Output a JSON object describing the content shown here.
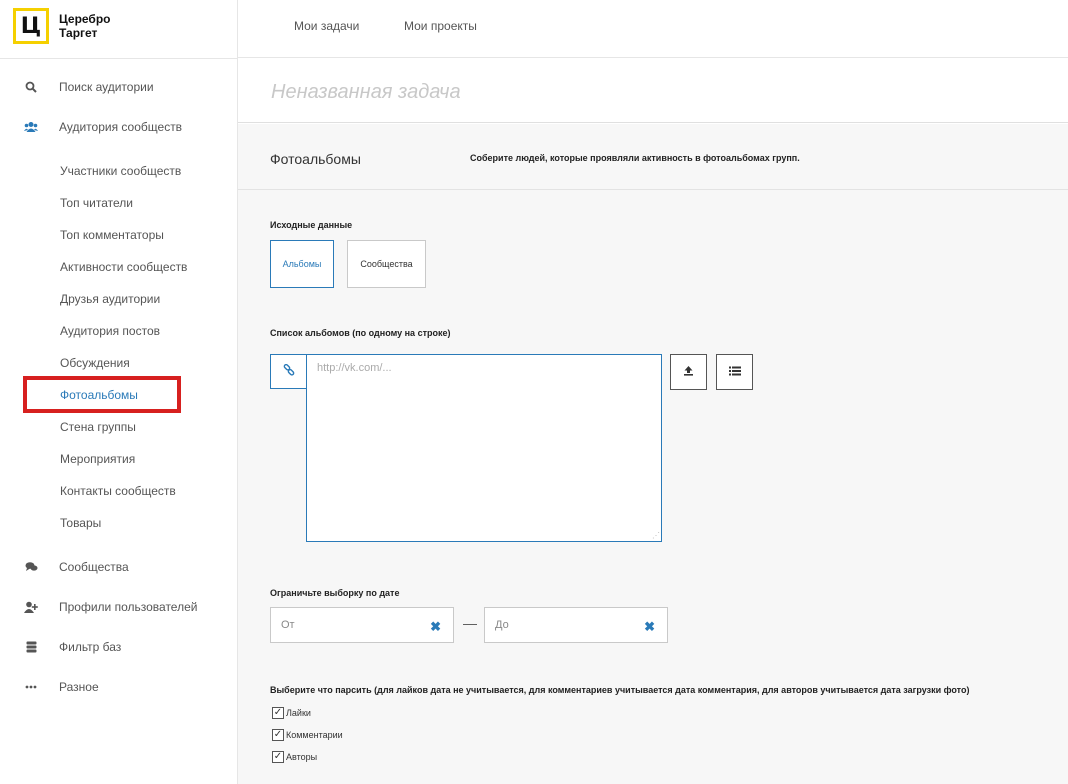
{
  "brand": {
    "logo_letter": "Ц",
    "line1": "Церебро",
    "line2": "Таргет",
    "logo_color": "#f5d000"
  },
  "topbar": {
    "tabs": [
      "Мои задачи",
      "Мои проекты"
    ]
  },
  "sidebar": {
    "items": [
      {
        "label": "Поиск аудитории",
        "icon": "search-icon"
      },
      {
        "label": "Аудитория сообществ",
        "icon": "users-icon"
      },
      {
        "label": "Сообщества",
        "icon": "chat-icon"
      },
      {
        "label": "Профили пользователей",
        "icon": "user-add-icon"
      },
      {
        "label": "Фильтр баз",
        "icon": "database-icon"
      },
      {
        "label": "Разное",
        "icon": "more-icon"
      }
    ],
    "subitems": [
      "Участники сообществ",
      "Топ читатели",
      "Топ комментаторы",
      "Активности сообществ",
      "Друзья аудитории",
      "Аудитория постов",
      "Обсуждения",
      "Фотоальбомы",
      "Стена группы",
      "Мероприятия",
      "Контакты сообществ",
      "Товары"
    ],
    "active_subitem": "Фотоальбомы",
    "highlight_color": "#d7201f"
  },
  "task": {
    "title_placeholder": "Неназванная задача"
  },
  "section": {
    "name": "Фотоальбомы",
    "description": "Соберите людей, которые проявляли активность в фотоальбомах групп."
  },
  "source": {
    "label": "Исходные данные",
    "options": [
      "Альбомы",
      "Сообщества"
    ],
    "selected": "Альбомы"
  },
  "albums": {
    "label": "Список альбомов (по одному на строке)",
    "placeholder": "http://vk.com/..."
  },
  "date_filter": {
    "label": "Ограничьте выборку по дате",
    "from_placeholder": "От",
    "to_placeholder": "До",
    "separator": "—"
  },
  "parse": {
    "label": "Выберите что парсить (для лайков дата не учитывается, для комментариев учитывается дата комментария, для авторов учитывается дата загрузки фото)",
    "options": [
      {
        "label": "Лайки",
        "checked": true
      },
      {
        "label": "Комментарии",
        "checked": true
      },
      {
        "label": "Авторы",
        "checked": true
      }
    ]
  },
  "accent_color": "#2a7ab8"
}
